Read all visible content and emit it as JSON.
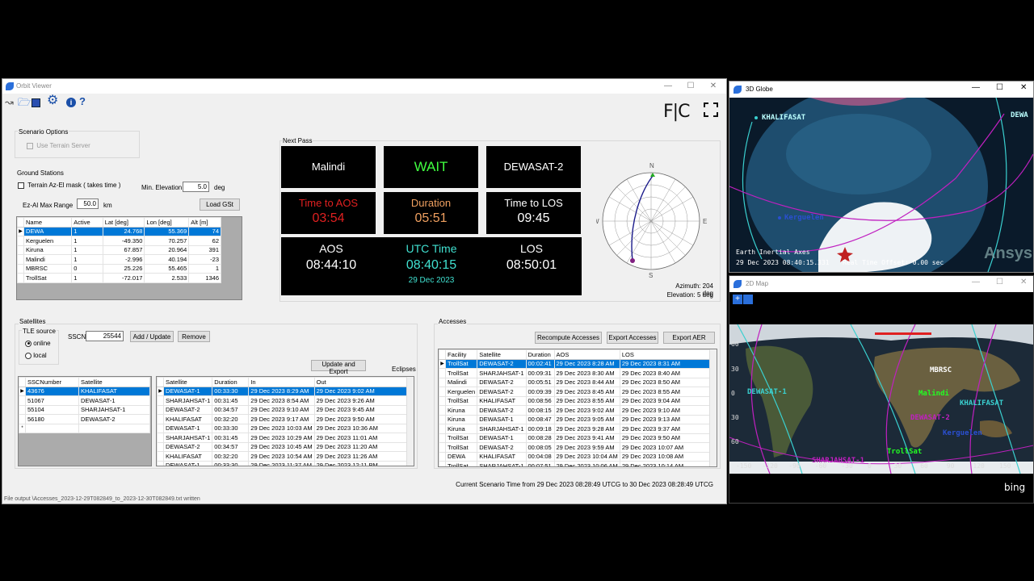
{
  "main_window": {
    "title": "Orbit Viewer",
    "brand": "F|C",
    "scenario_options": {
      "label": "Scenario Options",
      "use_terrain": "Use Terrain Server"
    },
    "ground_stations": {
      "label": "Ground Stations",
      "terrain_mask": "Terrain Az-El mask ( takes time )",
      "min_elev_label": "Min. Elevation",
      "min_elev_value": "5.0",
      "min_elev_unit": "deg",
      "ezel_label": "Ez-Al Max Range",
      "ezel_value": "50.0",
      "ezel_unit": "km",
      "load_button": "Load GSt",
      "columns": [
        "Name",
        "Active",
        "Lat [deg]",
        "Lon [deg]",
        "Alt [m]"
      ],
      "rows": [
        [
          "DEWA",
          "1",
          "24.768",
          "55.369",
          "74"
        ],
        [
          "Kerguelen",
          "1",
          "-49.350",
          "70.257",
          "62"
        ],
        [
          "Kiruna",
          "1",
          "67.857",
          "20.964",
          "391"
        ],
        [
          "Malindi",
          "1",
          "-2.996",
          "40.194",
          "-23"
        ],
        [
          "MBRSC",
          "0",
          "25.226",
          "55.465",
          "1"
        ],
        [
          "TrollSat",
          "1",
          "-72.017",
          "2.533",
          "1346"
        ]
      ]
    },
    "next_pass": {
      "label": "Next Pass",
      "station": "Malindi",
      "status": "WAIT",
      "satellite": "DEWASAT-2",
      "time_to_aos_label": "Time to AOS",
      "time_to_aos": "03:54",
      "duration_label": "Duration",
      "duration": "05:51",
      "time_to_los_label": "Time to LOS",
      "time_to_los": "09:45",
      "aos_label": "AOS",
      "aos": "08:44:10",
      "utc_label": "UTC Time",
      "utc": "08:40:15",
      "utc_date": "29 Dec 2023",
      "los_label": "LOS",
      "los": "08:50:01",
      "colors": {
        "aos": "#e02020",
        "duration": "#f0a060",
        "utc": "#40e0d0",
        "wait": "#40ff40"
      }
    },
    "polar": {
      "n": "N",
      "e": "E",
      "s": "S",
      "w": "W",
      "azimuth_label": "Azimuth:",
      "azimuth": "204 deg",
      "elevation_label": "Elevation:",
      "elevation": "5 deg"
    },
    "satellites": {
      "label": "Satellites",
      "tle_label": "TLE source",
      "online": "online",
      "local": "local",
      "sscn_label": "SSCN",
      "sscn_value": "25544",
      "add_button": "Add / Update",
      "remove_button": "Remove",
      "update_export_button": "Update and Export",
      "eclipses_label": "Eclipses",
      "columns": [
        "SSCNumber",
        "Satellite"
      ],
      "rows": [
        [
          "43676",
          "KHALIFASAT"
        ],
        [
          "51067",
          "DEWASAT-1"
        ],
        [
          "55104",
          "SHARJAHSAT-1"
        ],
        [
          "56180",
          "DEWASAT-2"
        ]
      ],
      "new_row_marker": "*"
    },
    "eclipses": {
      "columns": [
        "Satellite",
        "Duration",
        "In",
        "Out"
      ],
      "rows": [
        [
          "DEWASAT-1",
          "00:33:30",
          "29 Dec 2023 8:29 AM",
          "29 Dec 2023 9:02 AM"
        ],
        [
          "SHARJAHSAT-1",
          "00:31:45",
          "29 Dec 2023 8:54 AM",
          "29 Dec 2023 9:26 AM"
        ],
        [
          "DEWASAT-2",
          "00:34:57",
          "29 Dec 2023 9:10 AM",
          "29 Dec 2023 9:45 AM"
        ],
        [
          "KHALIFASAT",
          "00:32:20",
          "29 Dec 2023 9:17 AM",
          "29 Dec 2023 9:50 AM"
        ],
        [
          "DEWASAT-1",
          "00:33:30",
          "29 Dec 2023 10:03 AM",
          "29 Dec 2023 10:36 AM"
        ],
        [
          "SHARJAHSAT-1",
          "00:31:45",
          "29 Dec 2023 10:29 AM",
          "29 Dec 2023 11:01 AM"
        ],
        [
          "DEWASAT-2",
          "00:34:57",
          "29 Dec 2023 10:45 AM",
          "29 Dec 2023 11:20 AM"
        ],
        [
          "KHALIFASAT",
          "00:32:20",
          "29 Dec 2023 10:54 AM",
          "29 Dec 2023 11:26 AM"
        ],
        [
          "DEWASAT-1",
          "00:33:30",
          "29 Dec 2023 11:37 AM",
          "29 Dec 2023 12:11 PM"
        ]
      ]
    },
    "accesses": {
      "label": "Accesses",
      "recompute_button": "Recompute Accesses",
      "export_button": "Export Accesses",
      "export_aer_button": "Export AER",
      "columns": [
        "Facility",
        "Satellite",
        "Duration",
        "AOS",
        "LOS"
      ],
      "rows": [
        [
          "TrollSat",
          "DEWASAT-2",
          "00:02:41",
          "29 Dec 2023 8:28 AM",
          "29 Dec 2023 8:31 AM"
        ],
        [
          "TrollSat",
          "SHARJAHSAT-1",
          "00:09:31",
          "29 Dec 2023 8:30 AM",
          "29 Dec 2023 8:40 AM"
        ],
        [
          "Malindi",
          "DEWASAT-2",
          "00:05:51",
          "29 Dec 2023 8:44 AM",
          "29 Dec 2023 8:50 AM"
        ],
        [
          "Kerguelen",
          "DEWASAT-2",
          "00:09:39",
          "29 Dec 2023 8:45 AM",
          "29 Dec 2023 8:55 AM"
        ],
        [
          "TrollSat",
          "KHALIFASAT",
          "00:08:56",
          "29 Dec 2023 8:55 AM",
          "29 Dec 2023 9:04 AM"
        ],
        [
          "Kiruna",
          "DEWASAT-2",
          "00:08:15",
          "29 Dec 2023 9:02 AM",
          "29 Dec 2023 9:10 AM"
        ],
        [
          "Kiruna",
          "DEWASAT-1",
          "00:08:47",
          "29 Dec 2023 9:05 AM",
          "29 Dec 2023 9:13 AM"
        ],
        [
          "Kiruna",
          "SHARJAHSAT-1",
          "00:09:18",
          "29 Dec 2023 9:28 AM",
          "29 Dec 2023 9:37 AM"
        ],
        [
          "TrollSat",
          "DEWASAT-1",
          "00:08:28",
          "29 Dec 2023 9:41 AM",
          "29 Dec 2023 9:50 AM"
        ],
        [
          "TrollSat",
          "DEWASAT-2",
          "00:08:05",
          "29 Dec 2023 9:59 AM",
          "29 Dec 2023 10:07 AM"
        ],
        [
          "DEWA",
          "KHALIFASAT",
          "00:04:08",
          "29 Dec 2023 10:04 AM",
          "29 Dec 2023 10:08 AM"
        ],
        [
          "TrollSat",
          "SHARJAHSAT-1",
          "00:07:51",
          "29 Dec 2023 10:06 AM",
          "29 Dec 2023 10:14 AM"
        ]
      ]
    },
    "scenario_time": "Current Scenario Time from 29 Dec 2023 08:28:49 UTCG to 30 Dec 2023 08:28:49 UTCG",
    "status_bar": "File output \\Accesses_2023-12-29T082849_to_2023-12-30T082849.txt written"
  },
  "globe_window": {
    "title": "3D Globe",
    "labels": {
      "khalifasat": "KHALIFASAT",
      "dewa": "DEWA",
      "kerguelen": "Kerguelen"
    },
    "axes_label": "Earth Inertial Axes",
    "time_label": "29 Dec 2023 08:40:15.331",
    "offset_label": "Real Time Offset: 0.00 sec",
    "watermark": "Ansys"
  },
  "map_window": {
    "title": "2D Map",
    "labels": {
      "mbrsc": "MBRSC",
      "malindi": "Malindi",
      "khalifasat": "KHALIFASAT",
      "dewasat1": "DEWASAT-1",
      "dewasat2": "DEWASAT-2",
      "kerguelen": "Kerguelen",
      "trollsat": "TrollSat",
      "sharjahsat": "SHARJAHSAT-1"
    },
    "lat_ticks": [
      "60",
      "30",
      "0",
      "30",
      "60"
    ],
    "lon_ticks": [
      "-150",
      "-120",
      "-90",
      "-60",
      "-30",
      "0",
      "30",
      "60",
      "90",
      "120",
      "150"
    ],
    "bing": "bing"
  }
}
